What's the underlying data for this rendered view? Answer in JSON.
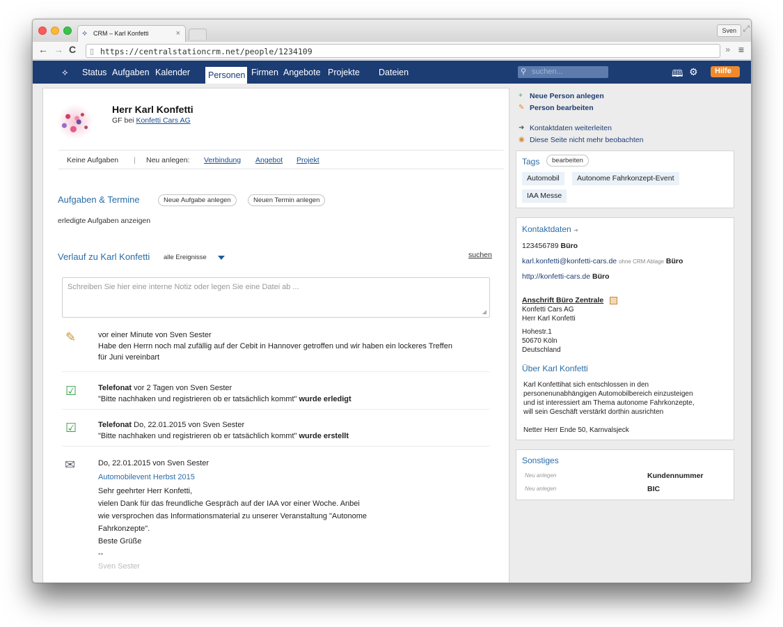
{
  "browser": {
    "tab_title": "CRM – Karl Konfetti",
    "user_button": "Sven",
    "url": "https://centralstationcrm.net/people/1234109"
  },
  "nav": {
    "items": [
      "Status",
      "Aufgaben",
      "Kalender",
      "Personen",
      "Firmen",
      "Angebote",
      "Projekte",
      "Dateien"
    ],
    "active": "Personen",
    "search_placeholder": "suchen...",
    "help_label": "Hilfe"
  },
  "person": {
    "name": "Herr Karl Konfetti",
    "role_prefix": "GF bei",
    "company": "Konfetti Cars AG"
  },
  "actions": {
    "no_tasks": "Keine Aufgaben",
    "separator": "|",
    "new_label": "Neu anlegen:",
    "links": [
      "Verbindung",
      "Angebot",
      "Projekt"
    ]
  },
  "tasks": {
    "title": "Aufgaben & Termine",
    "new_task_button": "Neue Aufgabe anlegen",
    "new_appointment_button": "Neuen Termin anlegen",
    "show_done": "erledigte Aufgaben anzeigen"
  },
  "history": {
    "title": "Verlauf zu Karl Konfetti",
    "filter": "alle Ereignisse",
    "search_link": "suchen",
    "note_placeholder": "Schreiben Sie hier eine interne Notiz oder legen Sie eine Datei ab ...",
    "events": [
      {
        "meta": "vor einer Minute von Sven Sester",
        "text1": "Habe den Herrn noch mal zufällig auf der Cebit in Hannover getroffen und wir haben ein lockeres Treffen",
        "text2": "für Juni vereinbart"
      },
      {
        "type": "Telefonat",
        "meta": "vor 2 Tagen von Sven Sester",
        "quote": "\"Bitte nachhaken und registrieren ob er tatsächlich kommt\"",
        "status": "wurde erledigt"
      },
      {
        "type": "Telefonat",
        "meta": "Do, 22.01.2015 von Sven Sester",
        "quote": "\"Bitte nachhaken und registrieren ob er tatsächlich kommt\"",
        "status": "wurde erstellt"
      },
      {
        "meta": "Do, 22.01.2015 von Sven Sester",
        "subject": "Automobilevent Herbst 2015",
        "greeting": "Sehr geehrter Herr Konfetti,",
        "body1": "vielen Dank für das freundliche Gespräch auf der IAA vor einer Woche. Anbei",
        "body2": "wie versprochen das Informationsmaterial zu unserer Veranstaltung \"Autonome",
        "body3": "Fahrkonzepte\".",
        "closing": "Beste Grüße",
        "dashes": "--",
        "signature": "Sven Sester"
      }
    ]
  },
  "sidebar": {
    "links": [
      "Neue Person anlegen",
      "Person bearbeiten",
      "Kontaktdaten weiterleiten",
      "Diese Seite nicht mehr beobachten"
    ],
    "tags": {
      "title": "Tags",
      "edit_button": "bearbeiten",
      "items": [
        "Automobil",
        "Autonome Fahrkonzept-Event",
        "IAA Messe"
      ]
    },
    "contact": {
      "title": "Kontaktdaten",
      "phone": "123456789",
      "phone_label": "Büro",
      "email": "karl.konfetti@konfetti-cars.de",
      "email_note": "ohne CRM Ablage",
      "email_label": "Büro",
      "web": "http://konfetti-cars.de",
      "web_label": "Büro",
      "address_title": "Anschrift Büro Zentrale",
      "address_lines": [
        "Konfetti Cars AG",
        "Herr Karl Konfetti",
        "Hohestr.1",
        "50670 Köln",
        "Deutschland"
      ]
    },
    "about": {
      "title": "Über Karl Konfetti",
      "text_lines": [
        "Karl Konfettihat sich entschlossen in den",
        "personenunabhängigen Automobilbereich einzusteigen",
        "und ist interessiert am Thema autonome Fahrkonzepte,",
        "will sein Geschäft verstärkt dorthin ausrichten"
      ],
      "note": "Netter Herr Ende 50, Karnvalsjeck"
    },
    "misc": {
      "title": "Sonstiges",
      "rows": [
        {
          "placeholder": "Neu anlegen",
          "label": "Kundennummer"
        },
        {
          "placeholder": "Neu anlegen",
          "label": "BIC"
        }
      ]
    }
  }
}
